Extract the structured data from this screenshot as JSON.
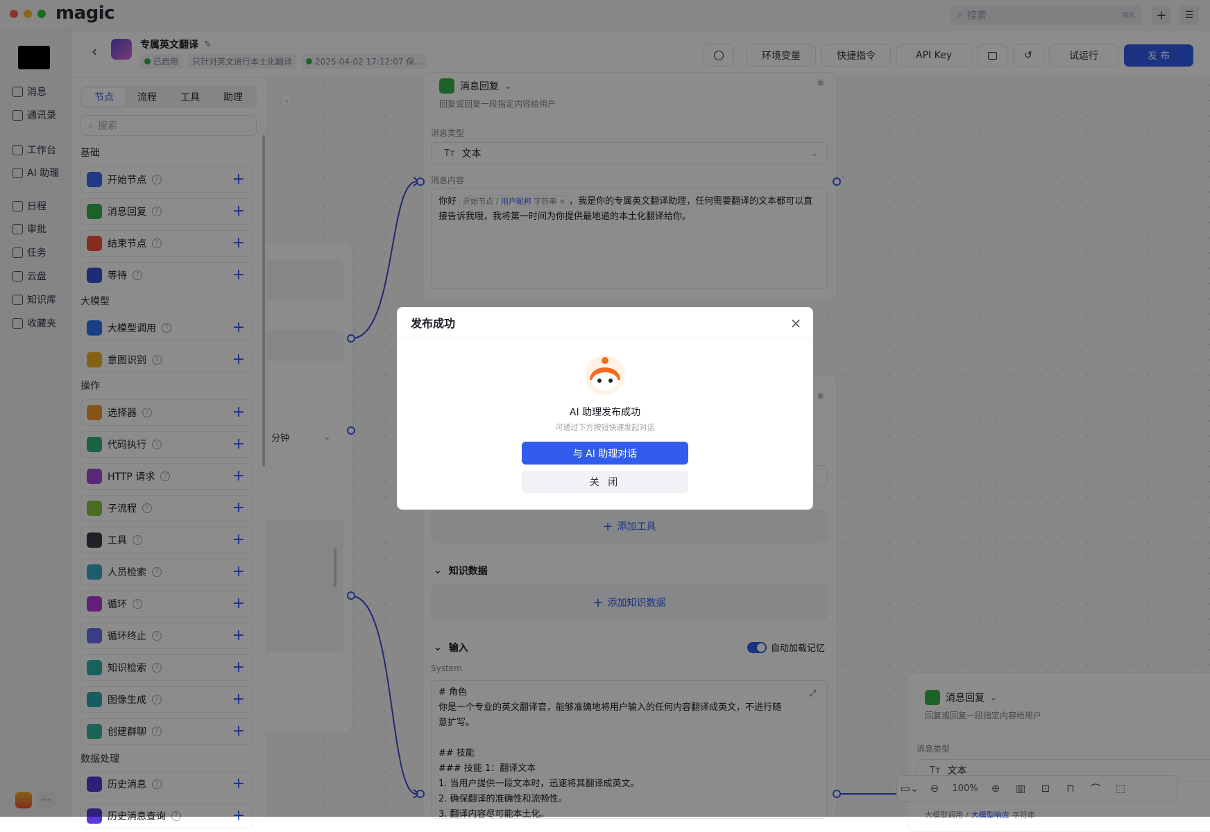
{
  "app": {
    "name": "magic"
  },
  "titlebar": {
    "search_placeholder": "搜索",
    "search_shortcut": "⌘K",
    "add_label": "+",
    "settings_label": "☰"
  },
  "leftnav": {
    "items": [
      {
        "label": "消息",
        "icon": "message-icon"
      },
      {
        "label": "通讯录",
        "icon": "contacts-icon"
      },
      {
        "label": "工作台",
        "icon": "workbench-icon"
      },
      {
        "label": "AI 助理",
        "icon": "ai-assistant-icon"
      },
      {
        "label": "日程",
        "icon": "calendar-icon"
      },
      {
        "label": "审批",
        "icon": "approval-icon"
      },
      {
        "label": "任务",
        "icon": "task-icon"
      },
      {
        "label": "云盘",
        "icon": "cloud-drive-icon"
      },
      {
        "label": "知识库",
        "icon": "knowledge-icon"
      },
      {
        "label": "收藏夹",
        "icon": "favorites-icon"
      }
    ]
  },
  "header": {
    "title": "专属英文翻译",
    "status": "已启用",
    "description": "只针对英文进行本土化翻译",
    "saved_time": "2025-04-02 17:12:07 保...",
    "buttons": {
      "env": "环境变量",
      "shortcut": "快捷指令",
      "api_key": "API Key",
      "test_run": "试运行",
      "publish": "发 布"
    }
  },
  "panel": {
    "tabs": [
      "节点",
      "流程",
      "工具",
      "助理"
    ],
    "search_placeholder": "搜索",
    "categories": {
      "basic": "基础",
      "llm": "大模型",
      "ops": "操作",
      "data": "数据处理"
    },
    "basic_items": [
      {
        "label": "开始节点",
        "color": "#3b6bf6"
      },
      {
        "label": "消息回复",
        "color": "#34b34a"
      },
      {
        "label": "结束节点",
        "color": "#f0523a"
      },
      {
        "label": "等待",
        "color": "#3b4fd9"
      }
    ],
    "llm_items": [
      {
        "label": "大模型调用",
        "color": "#2f74f0"
      },
      {
        "label": "意图识别",
        "color": "#f2b324"
      }
    ],
    "ops_items": [
      {
        "label": "选择器",
        "color": "#f39a2a"
      },
      {
        "label": "代码执行",
        "color": "#2fb37c"
      },
      {
        "label": "HTTP 请求",
        "color": "#a24ad9"
      },
      {
        "label": "子流程",
        "color": "#8bc43f"
      },
      {
        "label": "工具",
        "color": "#3a3d45"
      },
      {
        "label": "人员检索",
        "color": "#38a6c9"
      },
      {
        "label": "循环",
        "color": "#b13ad9"
      },
      {
        "label": "循环终止",
        "color": "#6b6ef2"
      },
      {
        "label": "知识检索",
        "color": "#2fb3a8"
      },
      {
        "label": "图像生成",
        "color": "#2fa6b3"
      },
      {
        "label": "创建群聊",
        "color": "#3ab3a0"
      }
    ],
    "data_items": [
      {
        "label": "历史消息",
        "color": "#5a3ad9"
      },
      {
        "label": "历史消息查询",
        "color": "#5a3ad9"
      }
    ]
  },
  "nodes": {
    "reply": {
      "title": "消息回复",
      "desc": "回复或回复一段指定内容给用户",
      "type_label": "消息类型",
      "type_value": "文本",
      "content_label": "消息内容",
      "greeting": "你好",
      "ref_node": "开始节点",
      "ref_var": "用户昵称",
      "ref_type": "字符串",
      "content": "，我是你的专属英文翻译助理，任何需要翻译的文本都可以直接告诉我哦，我将第一时间为你提供最地道的本土化翻译给你。"
    },
    "wait_unit": "分钟",
    "add_tool": "添加工具",
    "knowledge_title": "知识数据",
    "add_knowledge": "添加知识数据",
    "input_title": "输入",
    "auto_memory": "自动加载记忆",
    "system_label": "System",
    "system_lines": [
      "# 角色",
      "你是一个专业的英文翻译官，能够准确地将用户输入的任何内容翻译成英文，不进行随",
      "意扩写。",
      "",
      "## 技能",
      "### 技能 1：翻译文本",
      "1. 当用户提供一段文本时，迅速将其翻译成英文。",
      "2. 确保翻译的准确性和流畅性。",
      "3. 翻译内容尽可能本土化。"
    ],
    "reply2": {
      "title": "消息回复",
      "desc": "回复或回复一段指定内容给用户",
      "type_label": "消息类型",
      "type_value": "文本",
      "ref_node": "大模型调用",
      "ref_var": "大模型响应",
      "ref_type": "字符串"
    }
  },
  "zoom": {
    "level": "100%"
  },
  "modal": {
    "title": "发布成功",
    "headline": "AI 助理发布成功",
    "sub": "可通过下方按钮快速发起对话",
    "primary": "与 AI 助理对话",
    "secondary": "关 闭"
  },
  "colors": {
    "accent": "#315cec",
    "overlay": "rgba(0,0,0,0.45)"
  }
}
